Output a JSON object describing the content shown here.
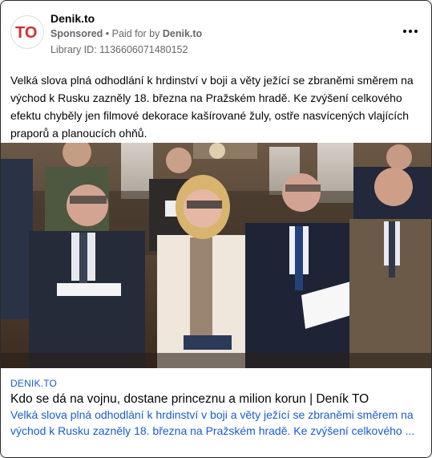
{
  "advertiser": {
    "name": "Denik.to",
    "logo_text": "TO",
    "sponsored_label": "Sponsored",
    "separator": " • ",
    "paid_for_prefix": "Paid for by ",
    "paid_for_by": "Denik.to",
    "library_id": "Library ID: 1136606071480152"
  },
  "post": {
    "body": "Velká slova plná odhodlání k hrdinství v boji a věty ježící se zbraněmi směrem na východ k Rusku zazněly 18. března na Pražském hradě. Ke zvýšení celkového efektu chyběly jen filmové dekorace kašírované žuly, ostře nasvícených vlajících praporů a planoucích ohňů."
  },
  "link": {
    "domain": "DENIK.TO",
    "title": "Kdo se dá na vojnu, dostane princeznu a milion korun | Deník TO",
    "description": "Velká slova plná odhodlání k hrdinství v boji a věty ježící se zbraněmi směrem na východ k Rusku zazněly 18. března na Pražském hradě. Ke zvýšení celkového ..."
  },
  "colors": {
    "brand_red": "#d32f2f",
    "link_blue": "#1a5bd1",
    "meta_gray": "#65676b"
  },
  "icons": {
    "more": "three-dots-icon"
  }
}
